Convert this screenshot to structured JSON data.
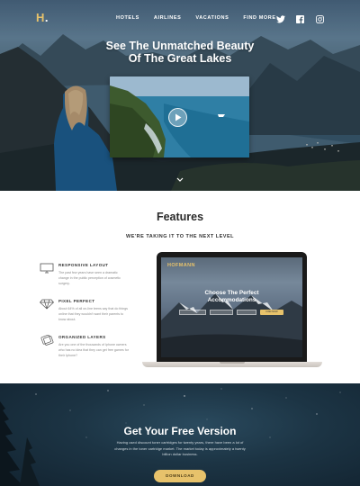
{
  "header": {
    "brand": "H",
    "brand_dot": ".",
    "nav": [
      "HOTELS",
      "AIRLINES",
      "VACATIONS",
      "FIND MORE"
    ],
    "social_icons": [
      "twitter-icon",
      "facebook-icon",
      "instagram-icon"
    ]
  },
  "hero": {
    "title_line1": "See The Unmatched Beauty",
    "title_line2": "Of The Great Lakes",
    "video_control": "play-icon"
  },
  "features": {
    "title": "Features",
    "subtitle": "WE'RE TAKING IT TO THE NEXT LEVEL",
    "items": [
      {
        "icon": "monitor-icon",
        "title": "RESPONSIVE LAYOUT",
        "description": "The past few years have seen a dramatic change in the public perception of cosmetic surgery."
      },
      {
        "icon": "diamond-icon",
        "title": "PIXEL PERFECT",
        "description": "About 64% of all on-line teens say that do things online that they wouldn't want their parents to know about."
      },
      {
        "icon": "layers-icon",
        "title": "ORGANIZED LAYERS",
        "description": "Are you one of the thousands of Iphone owners who has no idea that they can get free games for their Iphone?"
      }
    ]
  },
  "preview": {
    "logo": "HOFMANN",
    "title_line1": "Choose The Perfect",
    "title_line2": "Accommodations",
    "button": "FIND NOW"
  },
  "cta": {
    "title": "Get Your Free Version",
    "description": "Having used discount toner cartridges for twenty years, there have been a lot of changes in the toner cartridge market. The market today is approximately a twenty billion dollar business.",
    "button": "DOWNLOAD"
  },
  "colors": {
    "accent": "#e7c26b",
    "dark": "#2a2a2a",
    "muted": "#8a8a8a"
  }
}
